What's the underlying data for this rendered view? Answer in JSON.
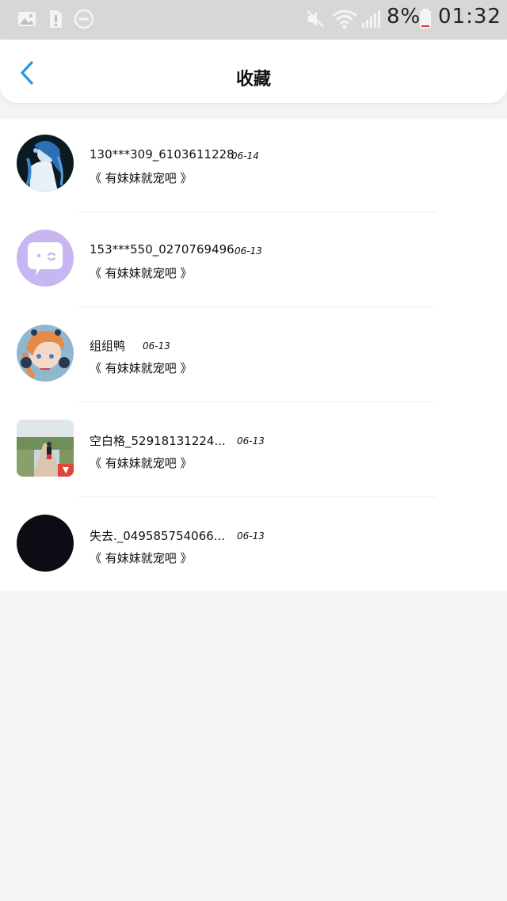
{
  "status_bar": {
    "battery_percent": "8%",
    "time": "01:32",
    "icons": [
      "image-icon",
      "sim-alert-icon",
      "do-not-disturb-icon",
      "mute-icon",
      "wifi-icon",
      "signal-icon",
      "battery-icon"
    ]
  },
  "header": {
    "back_icon": "chevron-left-icon",
    "title": "收藏"
  },
  "colors": {
    "accent": "#2a96e6",
    "status_bar_bg": "#d7d7d7",
    "page_bg": "#f5f4f5",
    "list_bg": "#ffffff"
  },
  "favorites": [
    {
      "name": "130***309_6103611228",
      "date": "06-14",
      "forum": "《 有妹妹就宠吧 》",
      "avatar": "anime-avatar-blue"
    },
    {
      "name": "153***550_0270769496",
      "date": "06-13",
      "forum": "《 有妹妹就宠吧 》",
      "avatar": "default-chat-avatar"
    },
    {
      "name": "组组鸭",
      "date": "06-13",
      "forum": "《 有妹妹就宠吧 》",
      "avatar": "anime-avatar-orange"
    },
    {
      "name": "空白格_52918131224...",
      "date": "06-13",
      "forum": "《 有妹妹就宠吧 》",
      "avatar": "photo-avatar-road"
    },
    {
      "name": "失去._049585754066...",
      "date": "06-13",
      "forum": "《 有妹妹就宠吧 》",
      "avatar": "black-avatar"
    }
  ]
}
